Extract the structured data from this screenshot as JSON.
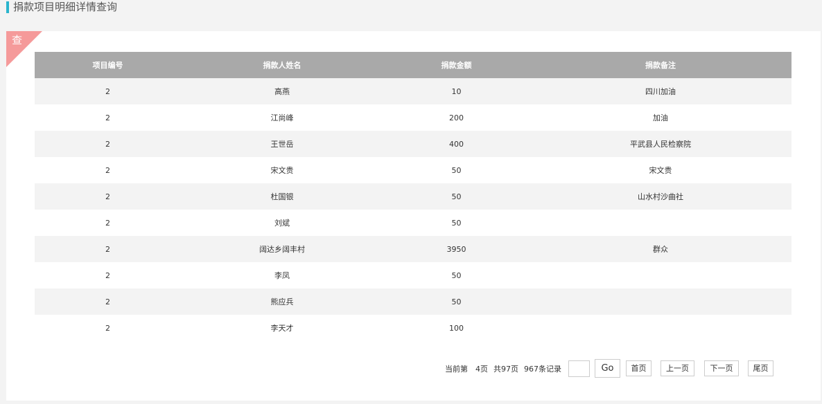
{
  "page": {
    "title": "捐款项目明细详情查询",
    "corner_label": "查"
  },
  "table": {
    "headers": [
      "项目编号",
      "捐款人姓名",
      "捐款金额",
      "捐款备注"
    ],
    "rows": [
      [
        "2",
        "高燕",
        "10",
        "四川加油"
      ],
      [
        "2",
        "江尚峰",
        "200",
        "加油"
      ],
      [
        "2",
        "王世岳",
        "400",
        "平武县人民检察院"
      ],
      [
        "2",
        "宋文贵",
        "50",
        "宋文贵"
      ],
      [
        "2",
        "杜国银",
        "50",
        "山水村沙曲社"
      ],
      [
        "2",
        "刘斌",
        "50",
        ""
      ],
      [
        "2",
        "阔达乡阔丰村",
        "3950",
        "群众"
      ],
      [
        "2",
        "李凤",
        "50",
        ""
      ],
      [
        "2",
        "熊应兵",
        "50",
        ""
      ],
      [
        "2",
        "李天才",
        "100",
        ""
      ]
    ]
  },
  "pager": {
    "current_label": "当前第",
    "current_page": "4页",
    "total_pages": "共97页",
    "total_records": "967条记录",
    "input_value": "",
    "go_label": "Go",
    "first_label": "首页",
    "prev_label": "上一页",
    "next_label": "下一页",
    "last_label": "尾页"
  }
}
